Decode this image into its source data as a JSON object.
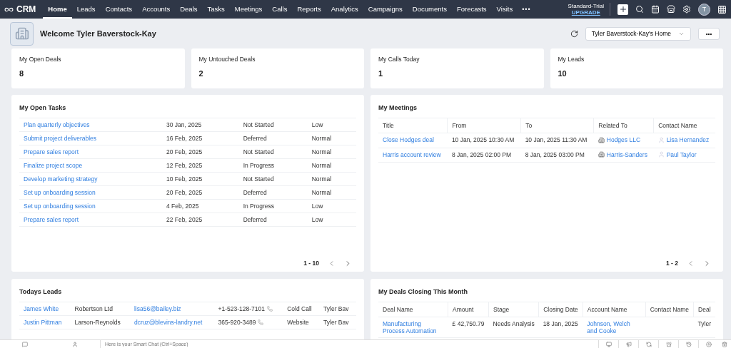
{
  "nav": {
    "logo": "CRM",
    "tabs": [
      {
        "label": "Home",
        "selected": true
      },
      {
        "label": "Leads",
        "selected": false
      },
      {
        "label": "Contacts",
        "selected": false
      },
      {
        "label": "Accounts",
        "selected": false
      },
      {
        "label": "Deals",
        "selected": false
      },
      {
        "label": "Tasks",
        "selected": false
      },
      {
        "label": "Meetings",
        "selected": false
      },
      {
        "label": "Calls",
        "selected": false
      },
      {
        "label": "Reports",
        "selected": false
      },
      {
        "label": "Analytics",
        "selected": false
      },
      {
        "label": "Campaigns",
        "selected": false
      },
      {
        "label": "Documents",
        "selected": false
      },
      {
        "label": "Forecasts",
        "selected": false
      },
      {
        "label": "Visits",
        "selected": false
      }
    ],
    "more": "•••",
    "plan": "Standard-Trial",
    "upgrade": "UPGRADE",
    "avatar": "T"
  },
  "header": {
    "welcome": "Welcome Tyler Baverstock-Kay",
    "home_select": "Tyler Baverstock-Kay's Home",
    "more": "•••"
  },
  "stats": [
    {
      "label": "My Open Deals",
      "value": "8"
    },
    {
      "label": "My Untouched Deals",
      "value": "2"
    },
    {
      "label": "My Calls Today",
      "value": "1"
    },
    {
      "label": "My Leads",
      "value": "10"
    }
  ],
  "tasks": {
    "title": "My Open Tasks",
    "columns": [
      {
        "kind": "link"
      },
      {
        "kind": "text"
      },
      {
        "kind": "text"
      },
      {
        "kind": "text"
      }
    ],
    "rows": [
      [
        "Plan quarterly objectives",
        "30 Jan, 2025",
        "Not Started",
        "Low"
      ],
      [
        "Submit project deliverables",
        "16 Feb, 2025",
        "Deferred",
        "Normal"
      ],
      [
        "Prepare sales report",
        "20 Feb, 2025",
        "Not Started",
        "Normal"
      ],
      [
        "Finalize project scope",
        "12 Feb, 2025",
        "In Progress",
        "Normal"
      ],
      [
        "Develop marketing strategy",
        "10 Feb, 2025",
        "Not Started",
        "Normal"
      ],
      [
        "Set up onboarding session",
        "20 Feb, 2025",
        "Deferred",
        "Normal"
      ],
      [
        "Set up onboarding session",
        "4 Feb, 2025",
        "In Progress",
        "Low"
      ],
      [
        "Prepare sales report",
        "22 Feb, 2025",
        "Deferred",
        "Low"
      ]
    ],
    "pagination": "1 - 10"
  },
  "meetings": {
    "title": "My Meetings",
    "columns": [
      {
        "label": "Title",
        "kind": "link"
      },
      {
        "label": "From",
        "kind": "text"
      },
      {
        "label": "To",
        "kind": "text"
      },
      {
        "label": "Related To",
        "kind": "account"
      },
      {
        "label": "Contact Name",
        "kind": "contact"
      }
    ],
    "rows": [
      [
        "Close Hodges deal",
        "10 Jan, 2025 10:30 AM",
        "10 Jan, 2025 11:30 AM",
        "Hodges LLC",
        "Lisa Hernandez"
      ],
      [
        "Harris account review",
        "8 Jan, 2025 02:00 PM",
        "8 Jan, 2025 03:00 PM",
        "Harris-Sanders",
        "Paul Taylor"
      ]
    ],
    "pagination": "1 - 2"
  },
  "leads": {
    "title": "Todays Leads",
    "columns": [
      {
        "kind": "link"
      },
      {
        "kind": "text"
      },
      {
        "kind": "link"
      },
      {
        "kind": "phone"
      },
      {
        "kind": "text"
      },
      {
        "kind": "text"
      }
    ],
    "rows": [
      [
        "James White",
        "Robertson Ltd",
        "lisa56@bailey.biz",
        "+1-523-128-7101",
        "Cold Call",
        "Tyler Bav"
      ],
      [
        "Justin Pittman",
        "Larson-Reynolds",
        "dcruz@blevins-landry.net",
        "365-920-3489",
        "Website",
        "Tyler Bav"
      ]
    ]
  },
  "deals": {
    "title": "My Deals Closing This Month",
    "columns": [
      {
        "label": "Deal Name",
        "kind": "link"
      },
      {
        "label": "Amount",
        "kind": "text"
      },
      {
        "label": "Stage",
        "kind": "text"
      },
      {
        "label": "Closing Date",
        "kind": "text"
      },
      {
        "label": "Account Name",
        "kind": "link"
      },
      {
        "label": "Contact Name",
        "kind": "text"
      },
      {
        "label": "Deal",
        "kind": "text"
      }
    ],
    "rows": [
      [
        "Manufacturing Process Automation",
        "£ 42,750.79",
        "Needs Analysis",
        "18 Jan, 2025",
        "Johnson, Welch and Cooke",
        "",
        "Tyler"
      ]
    ]
  },
  "bottom_bar": {
    "placeholder": "Here is your Smart Chat (Ctrl+Space)"
  }
}
